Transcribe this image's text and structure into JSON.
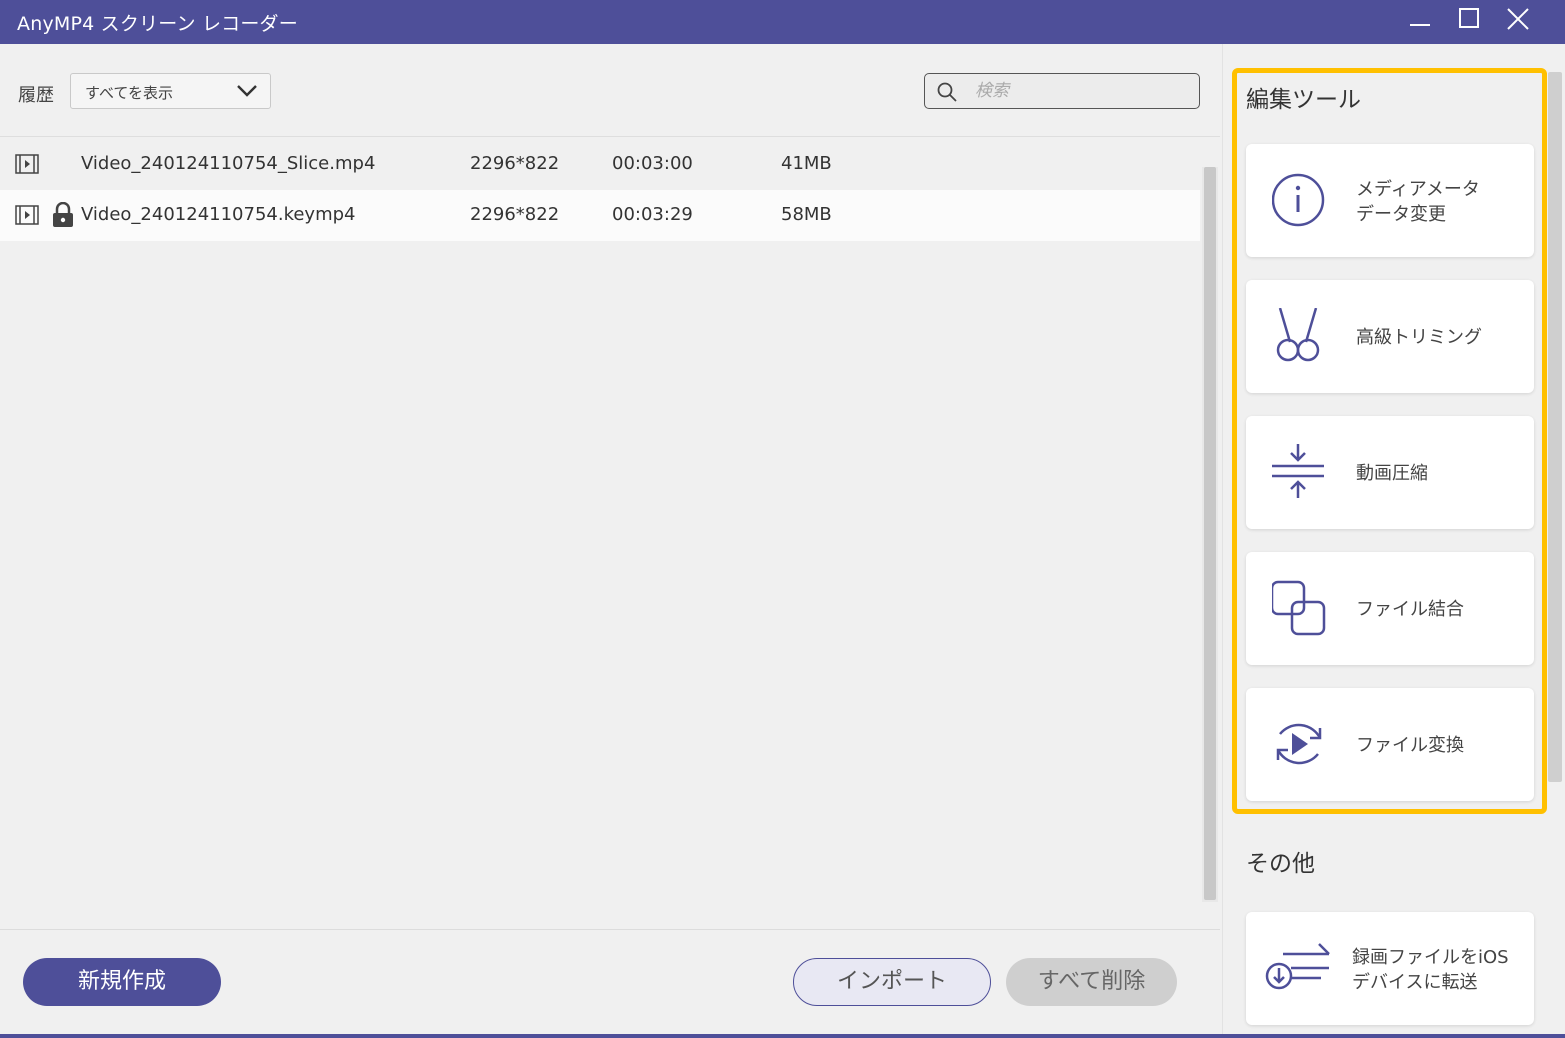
{
  "window": {
    "title": "AnyMP4 スクリーン レコーダー"
  },
  "history": {
    "label": "履歴",
    "filter_value": "すべてを表示"
  },
  "search": {
    "placeholder": "検索"
  },
  "files": [
    {
      "name": "Video_240124110754_Slice.mp4",
      "resolution": "2296*822",
      "duration": "00:03:00",
      "size": "41MB",
      "locked": false
    },
    {
      "name": "Video_240124110754.keymp4",
      "resolution": "2296*822",
      "duration": "00:03:29",
      "size": "58MB",
      "locked": true
    }
  ],
  "buttons": {
    "new": "新規作成",
    "import": "インポート",
    "delete_all": "すべて削除"
  },
  "edit_tools": {
    "title": "編集ツール",
    "items": [
      {
        "label_line1": "メディアメータ",
        "label_line2": "データ変更",
        "icon": "info-icon"
      },
      {
        "label_line1": "高級トリミング",
        "label_line2": "",
        "icon": "scissors-icon"
      },
      {
        "label_line1": "動画圧縮",
        "label_line2": "",
        "icon": "compress-icon"
      },
      {
        "label_line1": "ファイル結合",
        "label_line2": "",
        "icon": "merge-icon"
      },
      {
        "label_line1": "ファイル変換",
        "label_line2": "",
        "icon": "convert-icon"
      }
    ]
  },
  "other": {
    "title": "その他",
    "items": [
      {
        "label_line1": "録画ファイルをiOS",
        "label_line2": "デバイスに転送",
        "icon": "transfer-icon"
      }
    ]
  },
  "colors": {
    "brand": "#4e4f99",
    "highlight": "#ffc000"
  }
}
